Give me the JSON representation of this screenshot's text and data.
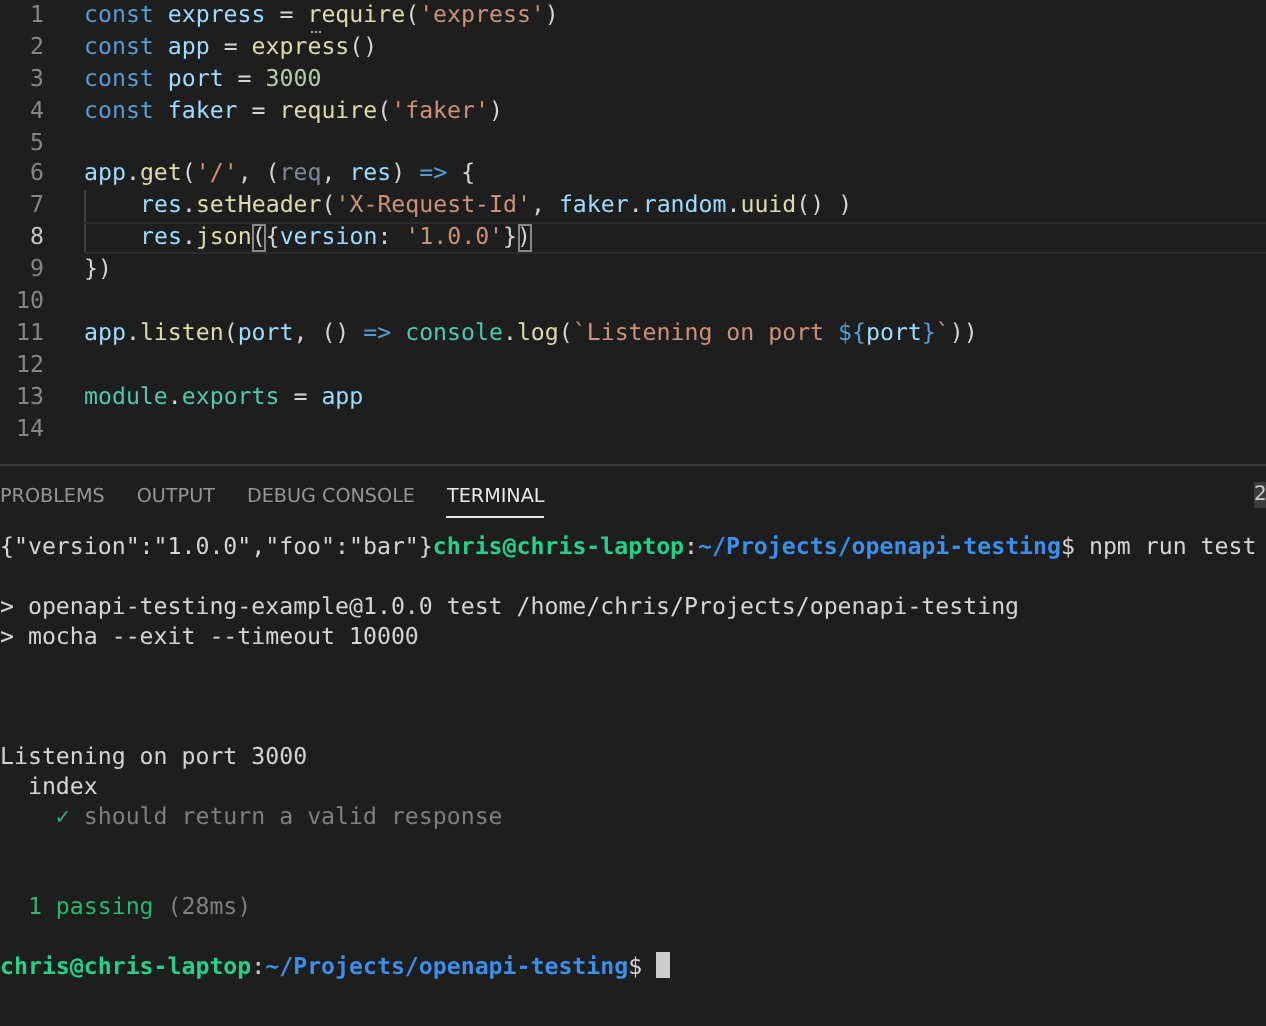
{
  "editor": {
    "lines": [
      {
        "number": "1",
        "tokens": [
          {
            "t": "const ",
            "kind": "kw"
          },
          {
            "t": "express",
            "kind": "var"
          },
          {
            "t": " = ",
            "kind": "plain"
          },
          {
            "t": "require",
            "kind": "fn",
            "hint": true
          },
          {
            "t": "(",
            "kind": "plain"
          },
          {
            "t": "'express'",
            "kind": "str"
          },
          {
            "t": ")",
            "kind": "plain"
          }
        ]
      },
      {
        "number": "2",
        "tokens": [
          {
            "t": "const ",
            "kind": "kw"
          },
          {
            "t": "app",
            "kind": "var"
          },
          {
            "t": " = ",
            "kind": "plain"
          },
          {
            "t": "express",
            "kind": "fn"
          },
          {
            "t": "()",
            "kind": "plain"
          }
        ]
      },
      {
        "number": "3",
        "tokens": [
          {
            "t": "const ",
            "kind": "kw"
          },
          {
            "t": "port",
            "kind": "var"
          },
          {
            "t": " = ",
            "kind": "plain"
          },
          {
            "t": "3000",
            "kind": "num"
          }
        ]
      },
      {
        "number": "4",
        "tokens": [
          {
            "t": "const ",
            "kind": "kw"
          },
          {
            "t": "faker",
            "kind": "var"
          },
          {
            "t": " = ",
            "kind": "plain"
          },
          {
            "t": "require",
            "kind": "fn"
          },
          {
            "t": "(",
            "kind": "plain"
          },
          {
            "t": "'faker'",
            "kind": "str"
          },
          {
            "t": ")",
            "kind": "plain"
          }
        ]
      },
      {
        "number": "5"
      },
      {
        "number": "6",
        "tokens": [
          {
            "t": "app",
            "kind": "var"
          },
          {
            "t": ".",
            "kind": "plain"
          },
          {
            "t": "get",
            "kind": "fn"
          },
          {
            "t": "(",
            "kind": "plain"
          },
          {
            "t": "'/'",
            "kind": "str"
          },
          {
            "t": ", (",
            "kind": "plain"
          },
          {
            "t": "req",
            "kind": "unused"
          },
          {
            "t": ", ",
            "kind": "plain"
          },
          {
            "t": "res",
            "kind": "var"
          },
          {
            "t": ") ",
            "kind": "plain"
          },
          {
            "t": "=>",
            "kind": "kw"
          },
          {
            "t": " {",
            "kind": "plain"
          }
        ]
      },
      {
        "number": "7",
        "indented": true,
        "tokens": [
          {
            "t": "res",
            "kind": "var"
          },
          {
            "t": ".",
            "kind": "plain"
          },
          {
            "t": "setHeader",
            "kind": "fn"
          },
          {
            "t": "(",
            "kind": "plain"
          },
          {
            "t": "'X-Request-Id'",
            "kind": "str"
          },
          {
            "t": ", ",
            "kind": "plain"
          },
          {
            "t": "faker",
            "kind": "var"
          },
          {
            "t": ".",
            "kind": "plain"
          },
          {
            "t": "random",
            "kind": "var"
          },
          {
            "t": ".",
            "kind": "plain"
          },
          {
            "t": "uuid",
            "kind": "fn"
          },
          {
            "t": "() )",
            "kind": "plain"
          }
        ]
      },
      {
        "number": "8",
        "current": true,
        "indented": true,
        "tokens": [
          {
            "t": "res",
            "kind": "var"
          },
          {
            "t": ".",
            "kind": "plain"
          },
          {
            "t": "json",
            "kind": "fn"
          },
          {
            "t": "(",
            "kind": "match"
          },
          {
            "t": "{",
            "kind": "plain"
          },
          {
            "t": "version",
            "kind": "var"
          },
          {
            "t": ": ",
            "kind": "plain"
          },
          {
            "t": "'1.0.0'",
            "kind": "str"
          },
          {
            "t": "}",
            "kind": "plain"
          },
          {
            "t": ")",
            "kind": "match"
          }
        ]
      },
      {
        "number": "9",
        "tokens": [
          {
            "t": "})",
            "kind": "plain"
          }
        ]
      },
      {
        "number": "10"
      },
      {
        "number": "11",
        "tokens": [
          {
            "t": "app",
            "kind": "var"
          },
          {
            "t": ".",
            "kind": "plain"
          },
          {
            "t": "listen",
            "kind": "fn"
          },
          {
            "t": "(",
            "kind": "plain"
          },
          {
            "t": "port",
            "kind": "var"
          },
          {
            "t": ", () ",
            "kind": "plain"
          },
          {
            "t": "=> ",
            "kind": "kw"
          },
          {
            "t": "console",
            "kind": "type"
          },
          {
            "t": ".",
            "kind": "plain"
          },
          {
            "t": "log",
            "kind": "fn"
          },
          {
            "t": "(",
            "kind": "plain"
          },
          {
            "t": "`Listening on port ",
            "kind": "str"
          },
          {
            "t": "${",
            "kind": "kw"
          },
          {
            "t": "port",
            "kind": "var"
          },
          {
            "t": "}",
            "kind": "kw"
          },
          {
            "t": "`",
            "kind": "str"
          },
          {
            "t": "))",
            "kind": "plain"
          }
        ]
      },
      {
        "number": "12"
      },
      {
        "number": "13",
        "tokens": [
          {
            "t": "module",
            "kind": "type"
          },
          {
            "t": ".",
            "kind": "plain"
          },
          {
            "t": "exports",
            "kind": "type"
          },
          {
            "t": " = ",
            "kind": "plain"
          },
          {
            "t": "app",
            "kind": "var"
          }
        ]
      },
      {
        "number": "14"
      }
    ]
  },
  "panel": {
    "tabs": [
      {
        "label": "PROBLEMS",
        "selected": false
      },
      {
        "label": "OUTPUT",
        "selected": false
      },
      {
        "label": "DEBUG CONSOLE",
        "selected": false
      },
      {
        "label": "TERMINAL",
        "selected": true
      }
    ],
    "terminal_selector": "2"
  },
  "terminal": {
    "lines": [
      {
        "kind": "text",
        "segments": [
          {
            "t": "{\"version\":\"1.0.0\",\"foo\":\"bar\"}",
            "kind": "plain"
          },
          {
            "t": "chris@chris-laptop",
            "kind": "user"
          },
          {
            "t": ":",
            "kind": "plain"
          },
          {
            "t": "~/Projects/openapi-testing",
            "kind": "path"
          },
          {
            "t": "$ npm run test",
            "kind": "plain"
          }
        ]
      },
      {
        "kind": "blank"
      },
      {
        "kind": "text",
        "segments": [
          {
            "t": "> openapi-testing-example@1.0.0 test /home/chris/Projects/openapi-testing",
            "kind": "plain"
          }
        ]
      },
      {
        "kind": "text",
        "segments": [
          {
            "t": "> mocha --exit --timeout 10000",
            "kind": "plain"
          }
        ]
      },
      {
        "kind": "blank"
      },
      {
        "kind": "blank"
      },
      {
        "kind": "blank"
      },
      {
        "kind": "text",
        "segments": [
          {
            "t": "Listening on port 3000",
            "kind": "plain"
          }
        ]
      },
      {
        "kind": "text",
        "segments": [
          {
            "t": "  index",
            "kind": "plain"
          }
        ]
      },
      {
        "kind": "text",
        "segments": [
          {
            "t": "    ✓",
            "kind": "pass"
          },
          {
            "t": " should return a valid response",
            "kind": "dim"
          }
        ]
      },
      {
        "kind": "blank"
      },
      {
        "kind": "blank"
      },
      {
        "kind": "text",
        "segments": [
          {
            "t": "  1 passing",
            "kind": "pass"
          },
          {
            "t": " (28ms)",
            "kind": "dim"
          }
        ]
      },
      {
        "kind": "blank"
      },
      {
        "kind": "text",
        "cursor": true,
        "segments": [
          {
            "t": "chris@chris-laptop",
            "kind": "user"
          },
          {
            "t": ":",
            "kind": "plain"
          },
          {
            "t": "~/Projects/openapi-testing",
            "kind": "path"
          },
          {
            "t": "$ ",
            "kind": "plain"
          }
        ]
      }
    ]
  }
}
